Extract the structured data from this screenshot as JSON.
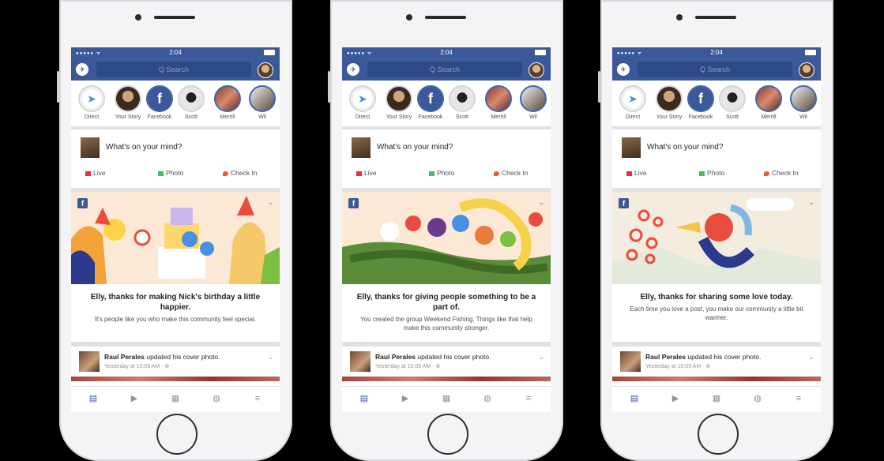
{
  "phones": [
    {
      "status_time": "2:04",
      "search_placeholder": "Q Search",
      "stories": [
        "Direct",
        "Your Story",
        "Facebook",
        "Scott",
        "Merrill",
        "Wil"
      ],
      "composer": {
        "prompt": "What's on your mind?",
        "live": "Live",
        "photo": "Photo",
        "checkin": "Check In"
      },
      "card": {
        "title": "Elly, thanks for making Nick's birthday a little happier.",
        "subtitle": "It's people like you who make this community feel special."
      },
      "post": {
        "author": "Raul Perales",
        "action": " updated his cover photo.",
        "meta": "Yesterday at 10:09 AM · ⊕"
      }
    },
    {
      "status_time": "2:04",
      "search_placeholder": "Q Search",
      "stories": [
        "Direct",
        "Your Story",
        "Facebook",
        "Scott",
        "Merrill",
        "Wil"
      ],
      "composer": {
        "prompt": "What's on your mind?",
        "live": "Live",
        "photo": "Photo",
        "checkin": "Check In"
      },
      "card": {
        "title": "Elly, thanks for giving people something to be a part of.",
        "subtitle": "You created the group Weekend Fishing. Things like that help make this community stronger."
      },
      "post": {
        "author": "Raul Perales",
        "action": " updated his cover photo.",
        "meta": "Yesterday at 10:09 AM · ⊕"
      }
    },
    {
      "status_time": "2:04",
      "search_placeholder": "Q Search",
      "stories": [
        "Direct",
        "Your Story",
        "Facebook",
        "Scott",
        "Merrill",
        "Wil"
      ],
      "composer": {
        "prompt": "What's on your mind?",
        "live": "Live",
        "photo": "Photo",
        "checkin": "Check In"
      },
      "card": {
        "title": "Elly, thanks for sharing some love today.",
        "subtitle": "Each time you love a post, you make our community a little bit warmer."
      },
      "post": {
        "author": "Raul Perales",
        "action": " updated his cover photo.",
        "meta": "Yesterday at 10:09 AM · ⊕"
      }
    }
  ],
  "colors": {
    "brand": "#3b5998",
    "background": "#000000",
    "live": "#f02849",
    "photo": "#45bd62",
    "checkin": "#f5533d"
  }
}
